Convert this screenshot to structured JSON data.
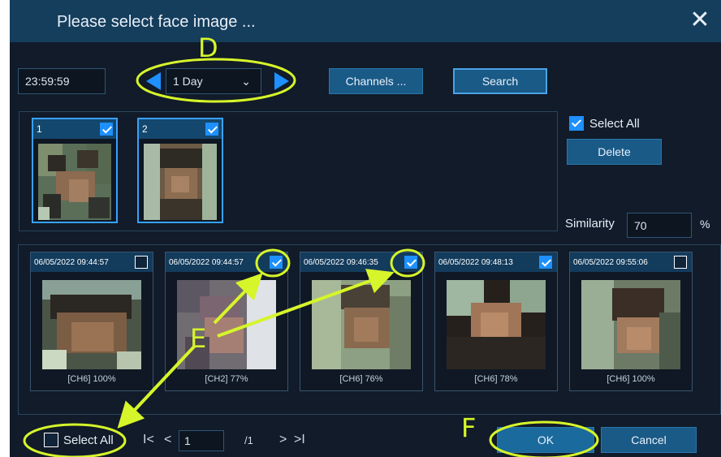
{
  "dialog": {
    "title": "Please select face image ...",
    "close_symbol": "✕"
  },
  "toolbar": {
    "end_time": "23:59:59",
    "period": "1 Day",
    "channels_label": "Channels ...",
    "search_label": "Search"
  },
  "selected_faces": {
    "items": [
      {
        "num": "1",
        "checked": true
      },
      {
        "num": "2",
        "checked": true
      }
    ],
    "select_all_label": "Select All",
    "select_all_checked": true,
    "delete_label": "Delete",
    "similarity_label": "Similarity",
    "similarity_value": "70",
    "similarity_unit": "%"
  },
  "results": {
    "items": [
      {
        "time": "06/05/2022 09:44:57",
        "caption": "[CH6] 100%",
        "checked": false
      },
      {
        "time": "06/05/2022 09:44:57",
        "caption": "[CH2] 77%",
        "checked": true
      },
      {
        "time": "06/05/2022 09:46:35",
        "caption": "[CH6] 76%",
        "checked": true
      },
      {
        "time": "06/05/2022 09:48:13",
        "caption": "[CH6] 78%",
        "checked": true
      },
      {
        "time": "06/05/2022 09:55:06",
        "caption": "[CH6] 100%",
        "checked": false
      }
    ]
  },
  "footer": {
    "select_all_label": "Select All",
    "select_all_checked": false,
    "page_current": "1",
    "page_total": "/1",
    "first_symbol": "I<",
    "prev_symbol": "<",
    "next_symbol": ">",
    "last_symbol": ">I",
    "ok_label": "OK",
    "cancel_label": "Cancel"
  },
  "annotations": {
    "d": "D",
    "e": "E",
    "f": "F",
    "color": "#d6f52a"
  }
}
